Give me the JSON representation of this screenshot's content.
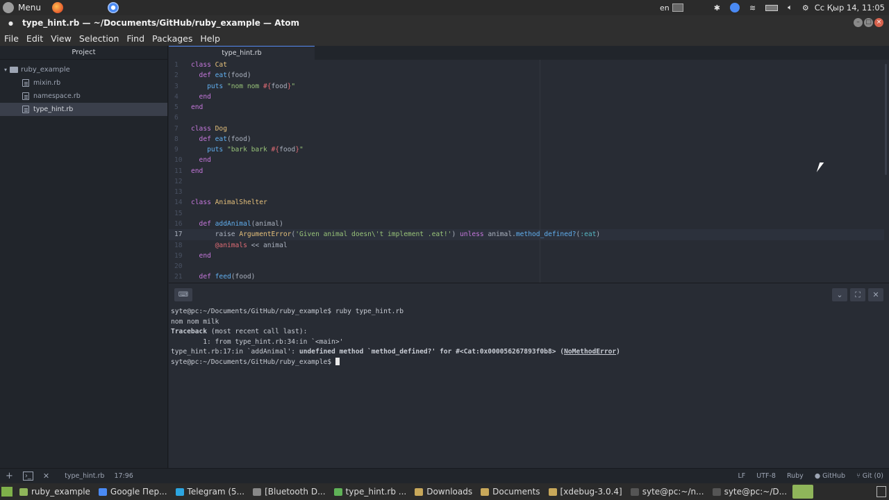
{
  "top_panel": {
    "menu_label": "Menu",
    "keyboard_layout": "en",
    "clock": "Сс Қыр 14, 11:05"
  },
  "window": {
    "title": "type_hint.rb — ~/Documents/GitHub/ruby_example — Atom"
  },
  "menubar": {
    "items": [
      "File",
      "Edit",
      "View",
      "Selection",
      "Find",
      "Packages",
      "Help"
    ]
  },
  "sidebar": {
    "header": "Project",
    "root": "ruby_example",
    "files": [
      "mixin.rb",
      "namespace.rb",
      "type_hint.rb"
    ],
    "selected": "type_hint.rb"
  },
  "editor": {
    "tab": "type_hint.rb",
    "current_line": 17,
    "lines": [
      {
        "n": "1"
      },
      {
        "n": "2"
      },
      {
        "n": "3"
      },
      {
        "n": "4"
      },
      {
        "n": "5"
      },
      {
        "n": "6"
      },
      {
        "n": "7"
      },
      {
        "n": "8"
      },
      {
        "n": "9"
      },
      {
        "n": "10"
      },
      {
        "n": "11"
      },
      {
        "n": "12"
      },
      {
        "n": "13"
      },
      {
        "n": "14"
      },
      {
        "n": "15"
      },
      {
        "n": "16"
      },
      {
        "n": "17"
      },
      {
        "n": "18"
      },
      {
        "n": "19"
      },
      {
        "n": "20"
      },
      {
        "n": "21"
      }
    ],
    "code": [
      [
        {
          "t": "class ",
          "c": "kw"
        },
        {
          "t": "Cat",
          "c": "cls"
        }
      ],
      [
        {
          "t": "  def ",
          "c": "kw"
        },
        {
          "t": "eat",
          "c": "fn"
        },
        {
          "t": "(food)",
          "c": ""
        }
      ],
      [
        {
          "t": "    puts ",
          "c": "fn"
        },
        {
          "t": "\"nom nom ",
          "c": "str"
        },
        {
          "t": "#{",
          "c": "var"
        },
        {
          "t": "food",
          "c": ""
        },
        {
          "t": "}",
          "c": "var"
        },
        {
          "t": "\"",
          "c": "str"
        }
      ],
      [
        {
          "t": "  end",
          "c": "kw"
        }
      ],
      [
        {
          "t": "end",
          "c": "kw"
        }
      ],
      [],
      [
        {
          "t": "class ",
          "c": "kw"
        },
        {
          "t": "Dog",
          "c": "cls"
        }
      ],
      [
        {
          "t": "  def ",
          "c": "kw"
        },
        {
          "t": "eat",
          "c": "fn"
        },
        {
          "t": "(food)",
          "c": ""
        }
      ],
      [
        {
          "t": "    puts ",
          "c": "fn"
        },
        {
          "t": "\"bark bark ",
          "c": "str"
        },
        {
          "t": "#{",
          "c": "var"
        },
        {
          "t": "food",
          "c": ""
        },
        {
          "t": "}",
          "c": "var"
        },
        {
          "t": "\"",
          "c": "str"
        }
      ],
      [
        {
          "t": "  end",
          "c": "kw"
        }
      ],
      [
        {
          "t": "end",
          "c": "kw"
        }
      ],
      [],
      [],
      [
        {
          "t": "class ",
          "c": "kw"
        },
        {
          "t": "AnimalShelter",
          "c": "cls"
        }
      ],
      [],
      [
        {
          "t": "  def ",
          "c": "kw"
        },
        {
          "t": "addAnimal",
          "c": "fn"
        },
        {
          "t": "(animal)",
          "c": ""
        }
      ],
      [
        {
          "t": "      raise ",
          "c": ""
        },
        {
          "t": "ArgumentError",
          "c": "cls"
        },
        {
          "t": "(",
          "c": ""
        },
        {
          "t": "'Given animal doesn\\'t implement .eat!'",
          "c": "str"
        },
        {
          "t": ") ",
          "c": ""
        },
        {
          "t": "unless ",
          "c": "kw"
        },
        {
          "t": "animal.",
          "c": ""
        },
        {
          "t": "method_defined?",
          "c": "fn"
        },
        {
          "t": "(",
          "c": ""
        },
        {
          "t": ":eat",
          "c": "sym"
        },
        {
          "t": ")",
          "c": ""
        }
      ],
      [
        {
          "t": "      @animals",
          "c": "var"
        },
        {
          "t": " << animal",
          "c": ""
        }
      ],
      [
        {
          "t": "  end",
          "c": "kw"
        }
      ],
      [],
      [
        {
          "t": "  def ",
          "c": "kw"
        },
        {
          "t": "feed",
          "c": "fn"
        },
        {
          "t": "(food)",
          "c": ""
        }
      ]
    ]
  },
  "terminal": {
    "line1": "syte@pc:~/Documents/GitHub/ruby_example$ ruby type_hint.rb",
    "line2": "nom nom milk",
    "line3_bold": "Traceback",
    "line3_rest": " (most recent call last):",
    "line4": "        1: from type_hint.rb:34:in `<main>'",
    "line5_a": "type_hint.rb:17:in `addAnimal': ",
    "line5_b": "undefined method `method_defined?' for #<Cat:0x000056267893f0b8> (",
    "line5_c": "NoMethodError",
    "line5_d": ")",
    "prompt": "syte@pc:~/Documents/GitHub/ruby_example$ "
  },
  "statusbar": {
    "file": "type_hint.rb",
    "position": "17:96",
    "line_ending": "LF",
    "encoding": "UTF-8",
    "grammar": "Ruby",
    "github": "GitHub",
    "git": "Git (0)"
  },
  "taskbar": {
    "items": [
      {
        "label": "ruby_example",
        "color": "#8fb55a"
      },
      {
        "label": "Google Пер...",
        "color": "#4a8af4"
      },
      {
        "label": "Telegram (5...",
        "color": "#2ca5e0"
      },
      {
        "label": "[Bluetooth D...",
        "color": "#888888"
      },
      {
        "label": "type_hint.rb ...",
        "color": "#5fb257"
      },
      {
        "label": "Downloads",
        "color": "#c8a85a"
      },
      {
        "label": "Documents",
        "color": "#c8a85a"
      },
      {
        "label": "[xdebug-3.0.4]",
        "color": "#c8a85a"
      },
      {
        "label": "syte@pc:~/n...",
        "color": "#555555"
      },
      {
        "label": "syte@pc:~/D...",
        "color": "#555555"
      }
    ]
  }
}
